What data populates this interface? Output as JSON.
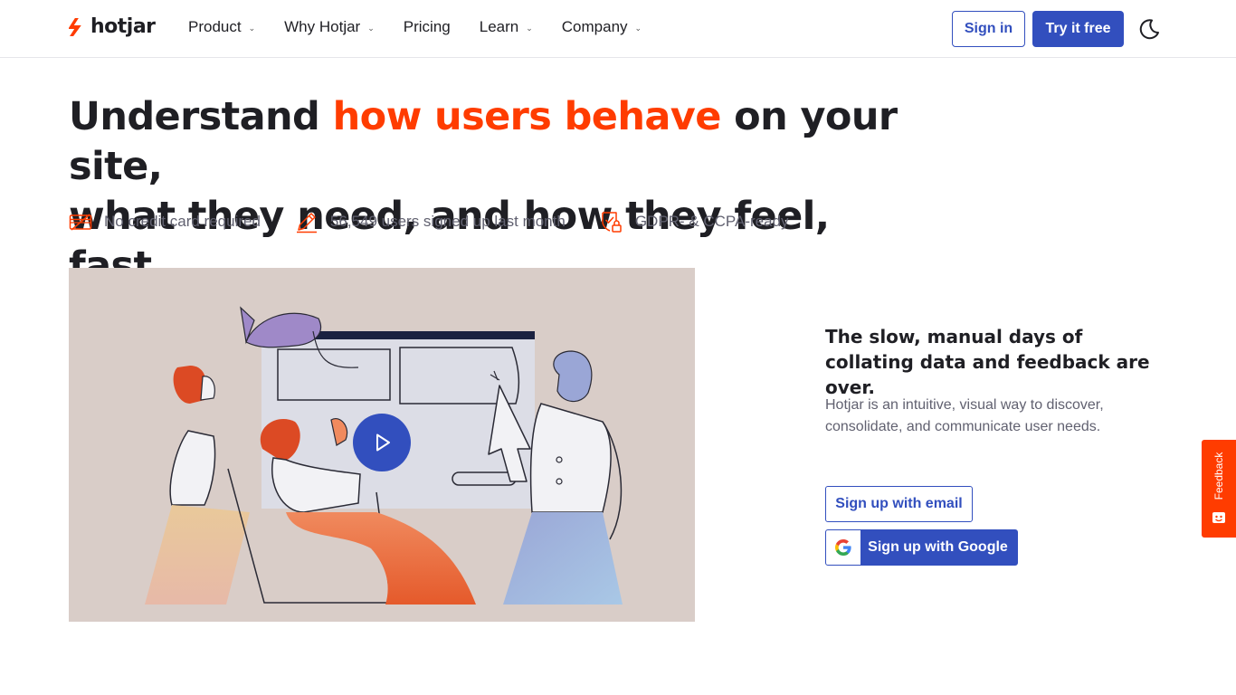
{
  "brand": {
    "name": "hotjar",
    "accent_color": "#ff3c00",
    "primary_color": "#324fbe"
  },
  "nav": {
    "items": [
      {
        "label": "Product",
        "has_dropdown": true
      },
      {
        "label": "Why Hotjar",
        "has_dropdown": true
      },
      {
        "label": "Pricing",
        "has_dropdown": false
      },
      {
        "label": "Learn",
        "has_dropdown": true
      },
      {
        "label": "Company",
        "has_dropdown": true
      }
    ],
    "chevron": "⌄",
    "sign_in": "Sign in",
    "try_free": "Try it free",
    "theme_icon": "moon-icon"
  },
  "hero": {
    "headline_pre": "Understand ",
    "headline_accent": "how users behave",
    "headline_line1_post": " on your site,",
    "headline_line2": "what they need, and how they feel, fast.",
    "badges": [
      {
        "icon": "credit-card-crossed-icon",
        "text": "No credit card required"
      },
      {
        "icon": "pencil-icon",
        "text": "56,549 users signed up last month"
      },
      {
        "icon": "shield-check-lock-icon",
        "text": "GDPR- & CCPA-ready"
      }
    ]
  },
  "video": {
    "play_icon": "play-icon",
    "background": "#d9cdc8"
  },
  "signup": {
    "title": "The slow, manual days of collating data and feedback are over.",
    "description": "Hotjar is an intuitive, visual way to discover, consolidate, and communicate user needs.",
    "email_button": "Sign up with email",
    "google_button": "Sign up with Google"
  },
  "feedback_tab": {
    "label": "Feedback",
    "icon": "feedback-face-icon"
  }
}
